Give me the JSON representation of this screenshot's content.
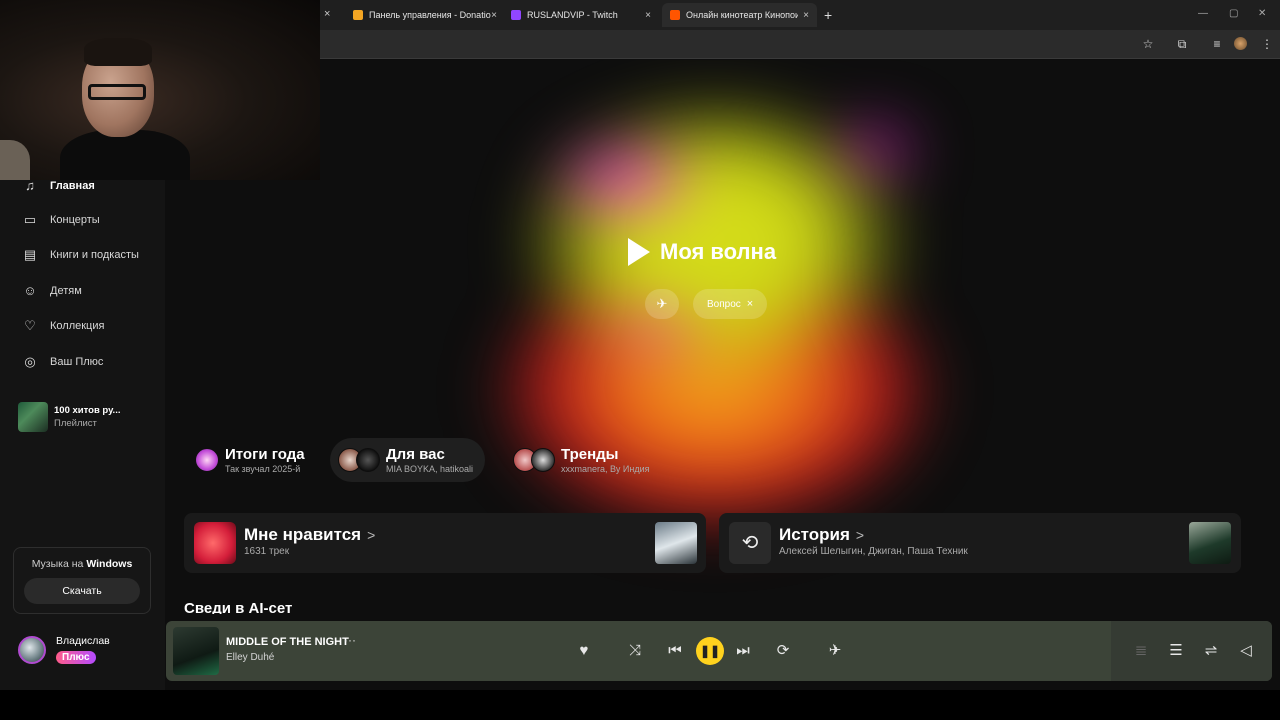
{
  "browser": {
    "tabs": [
      {
        "title": "Панель управления - Donatio",
        "color": "#f5a623"
      },
      {
        "title": "RUSLANDVIP - Twitch",
        "color": "#9146ff"
      },
      {
        "title": "Онлайн кинотеатр Кинопоиск",
        "color": "#ff5500"
      }
    ],
    "new_tab": "+",
    "close_glyph": "×"
  },
  "sidebar": {
    "items": [
      {
        "label": "Главная",
        "icon": "music-note-icon"
      },
      {
        "label": "Концерты",
        "icon": "ticket-icon"
      },
      {
        "label": "Книги и подкасты",
        "icon": "book-icon"
      },
      {
        "label": "Детям",
        "icon": "kids-icon"
      },
      {
        "label": "Коллекция",
        "icon": "heart-icon"
      },
      {
        "label": "Ваш Плюс",
        "icon": "plus-icon"
      }
    ],
    "playlist": {
      "title": "100 хитов ру...",
      "subtitle": "Плейлист"
    },
    "promo": {
      "text_prefix": "Музыка на ",
      "text_bold": "Windows",
      "button": "Скачать"
    },
    "user": {
      "name": "Владислав",
      "badge": "Плюс"
    }
  },
  "wave": {
    "title": "Моя волна",
    "pin_icon": "pin-icon",
    "question_label": "Вопрос",
    "question_close": "×"
  },
  "chips": [
    {
      "title": "Итоги года",
      "subtitle": "Так звучал 2025-й"
    },
    {
      "title": "Для вас",
      "subtitle": "MIA BOYKA, hatikoali"
    },
    {
      "title": "Тренды",
      "subtitle": "xxxmanera, Ву Индия"
    }
  ],
  "cards": {
    "likes": {
      "title": "Мне нравится",
      "arrow": ">",
      "subtitle": "1631 трек"
    },
    "history": {
      "title": "История",
      "arrow": ">",
      "subtitle": "Алексей Шелыгин, Джиган, Паша Техник"
    }
  },
  "section_title": "Сведи в AI-сет",
  "player": {
    "song": "MIDDLE OF THE NIGHT",
    "artist": "Elley Duhé",
    "more": "···",
    "accent": "#ffd21e"
  }
}
